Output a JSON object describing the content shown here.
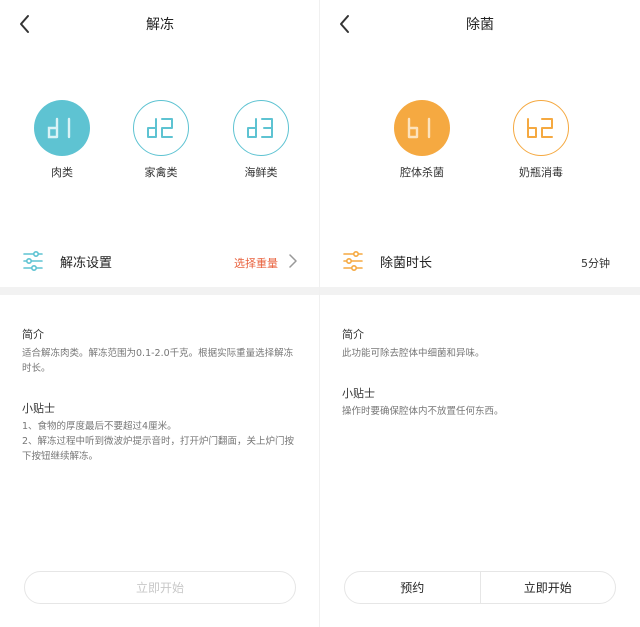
{
  "colors": {
    "teal": "#5ec3d2",
    "orange": "#f5a941",
    "accent_text": "#e9623e"
  },
  "left": {
    "title": "解冻",
    "modes": [
      {
        "code": "d1",
        "label": "肉类",
        "selected": true
      },
      {
        "code": "d2",
        "label": "家禽类",
        "selected": false
      },
      {
        "code": "d3",
        "label": "海鲜类",
        "selected": false
      }
    ],
    "setting": {
      "label": "解冻设置",
      "value": "选择重量",
      "icon": "sliders-icon"
    },
    "intro": {
      "title": "简介",
      "text": "适合解冻肉类。解冻范围为0.1-2.0千克。根据实际重量选择解冻时长。"
    },
    "tips": {
      "title": "小贴士",
      "lines": [
        "1、食物的厚度最后不要超过4厘米。",
        "2、解冻过程中听到微波炉提示音时，打开炉门翻面，关上炉门按下按钮继续解冻。"
      ]
    },
    "start_button": "立即开始"
  },
  "right": {
    "title": "除菌",
    "modes": [
      {
        "code": "b1",
        "label": "腔体杀菌",
        "selected": true
      },
      {
        "code": "b2",
        "label": "奶瓶消毒",
        "selected": false
      }
    ],
    "setting": {
      "label": "除菌时长",
      "value": "5分钟",
      "icon": "sliders-icon"
    },
    "intro": {
      "title": "简介",
      "text": "此功能可除去腔体中细菌和异味。"
    },
    "tips": {
      "title": "小贴士",
      "text": "操作时要确保腔体内不放置任何东西。"
    },
    "reserve_button": "预约",
    "start_button": "立即开始"
  }
}
